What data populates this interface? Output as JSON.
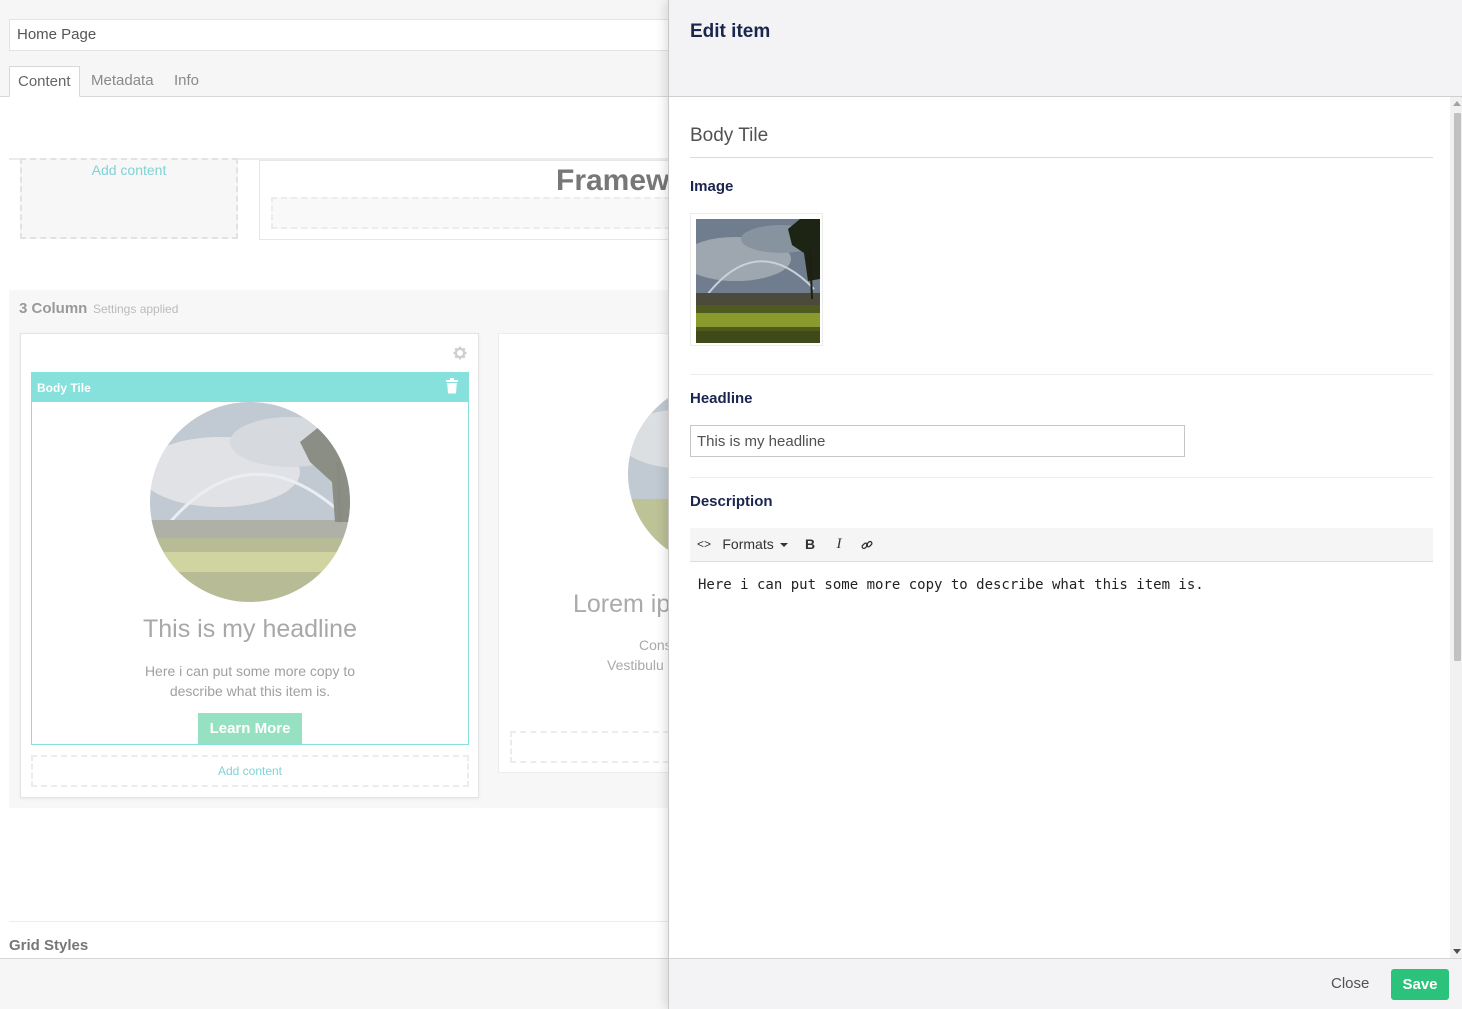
{
  "editor": {
    "page_name": "Home Page",
    "tabs": [
      "Content",
      "Metadata",
      "Info"
    ],
    "add_content_top": "Add content",
    "frame_heading": "Framew",
    "row": {
      "title": "3 Column",
      "subtitle": "Settings applied",
      "tile": {
        "header_label": "Body Tile",
        "headline": "This is my headline",
        "description": "Here i can put some more copy to describe what this item is.",
        "button_label": "Learn More",
        "add_content": "Add content"
      },
      "col2": {
        "headline": "Lorem ip",
        "line1": "Cons",
        "line2": "Vestibulu"
      }
    },
    "grid_styles": "Grid Styles"
  },
  "panel": {
    "title": "Edit item",
    "item_name": "Body Tile",
    "image_label": "Image",
    "headline_label": "Headline",
    "headline_value": "This is my headline",
    "description_label": "Description",
    "toolbar": {
      "code_icon": "<>",
      "formats_label": "Formats",
      "bold": "B",
      "italic": "I",
      "link_icon": "link-icon"
    },
    "description_text": "Here i can put some more copy to describe what this item is.",
    "close_label": "Close",
    "save_label": "Save"
  },
  "colors": {
    "accent_teal": "#86e0dc",
    "learn_more_green": "#96e1c2",
    "save_green": "#2bc37c",
    "panel_title_navy": "#1b264f"
  }
}
